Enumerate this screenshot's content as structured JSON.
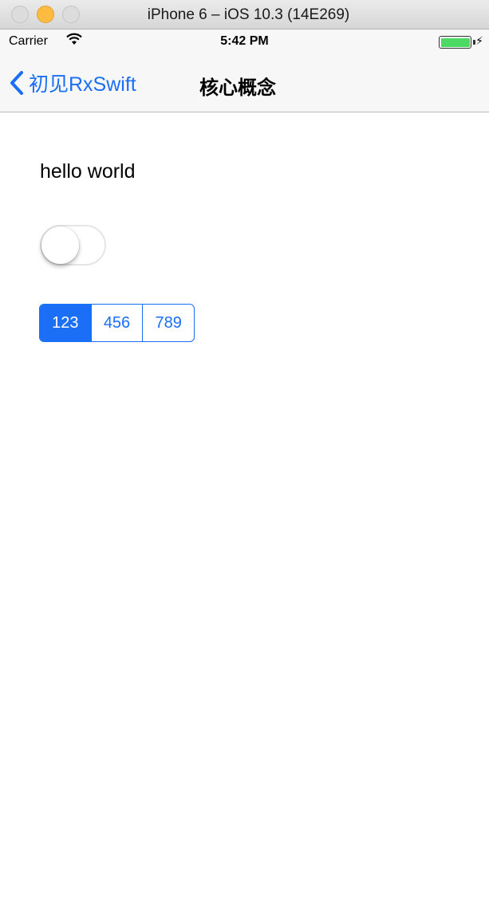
{
  "window": {
    "title": "iPhone 6 – iOS 10.3 (14E269)"
  },
  "status_bar": {
    "carrier": "Carrier",
    "time": "5:42 PM",
    "battery_color": "#4cd964"
  },
  "nav": {
    "back_label": "初见RxSwift",
    "title": "核心概念"
  },
  "content": {
    "label_text": "hello world",
    "switch_on": false,
    "segments": [
      "123",
      "456",
      "789"
    ],
    "selected_segment": 0
  },
  "colors": {
    "tint": "#1a6ff6"
  }
}
